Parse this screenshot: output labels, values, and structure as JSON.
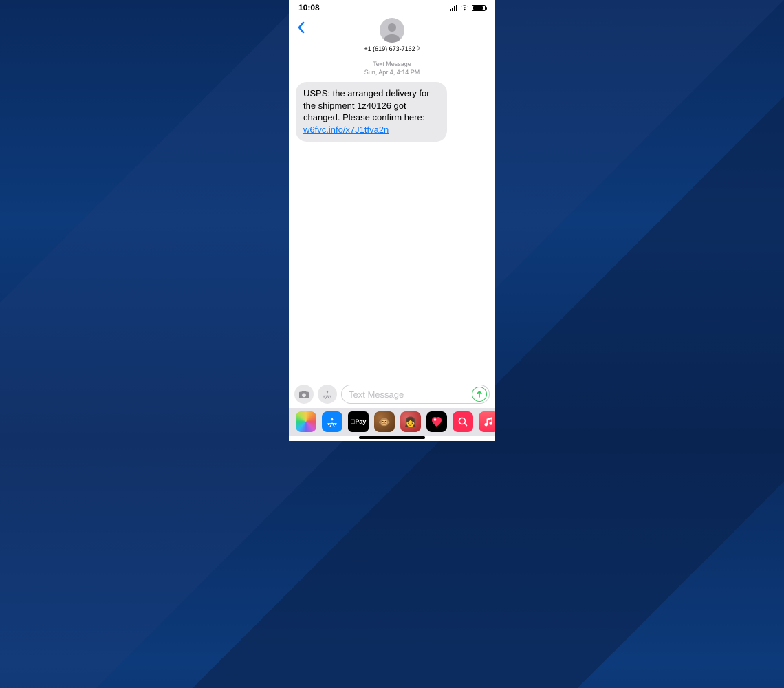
{
  "status": {
    "time": "10:08"
  },
  "header": {
    "contact_number": "+1 (619) 673-7162"
  },
  "thread": {
    "meta_type": "Text Message",
    "meta_time": "Sun, Apr 4, 4:14 PM",
    "message_text_pre": "USPS: the arranged delivery  for the shipment 1z40126 got changed. Please confirm here: ",
    "message_link": "w6fvc.info/x7J1tfva2n"
  },
  "compose": {
    "placeholder": "Text Message"
  },
  "apps": {
    "apple_pay_label": "Pay"
  }
}
